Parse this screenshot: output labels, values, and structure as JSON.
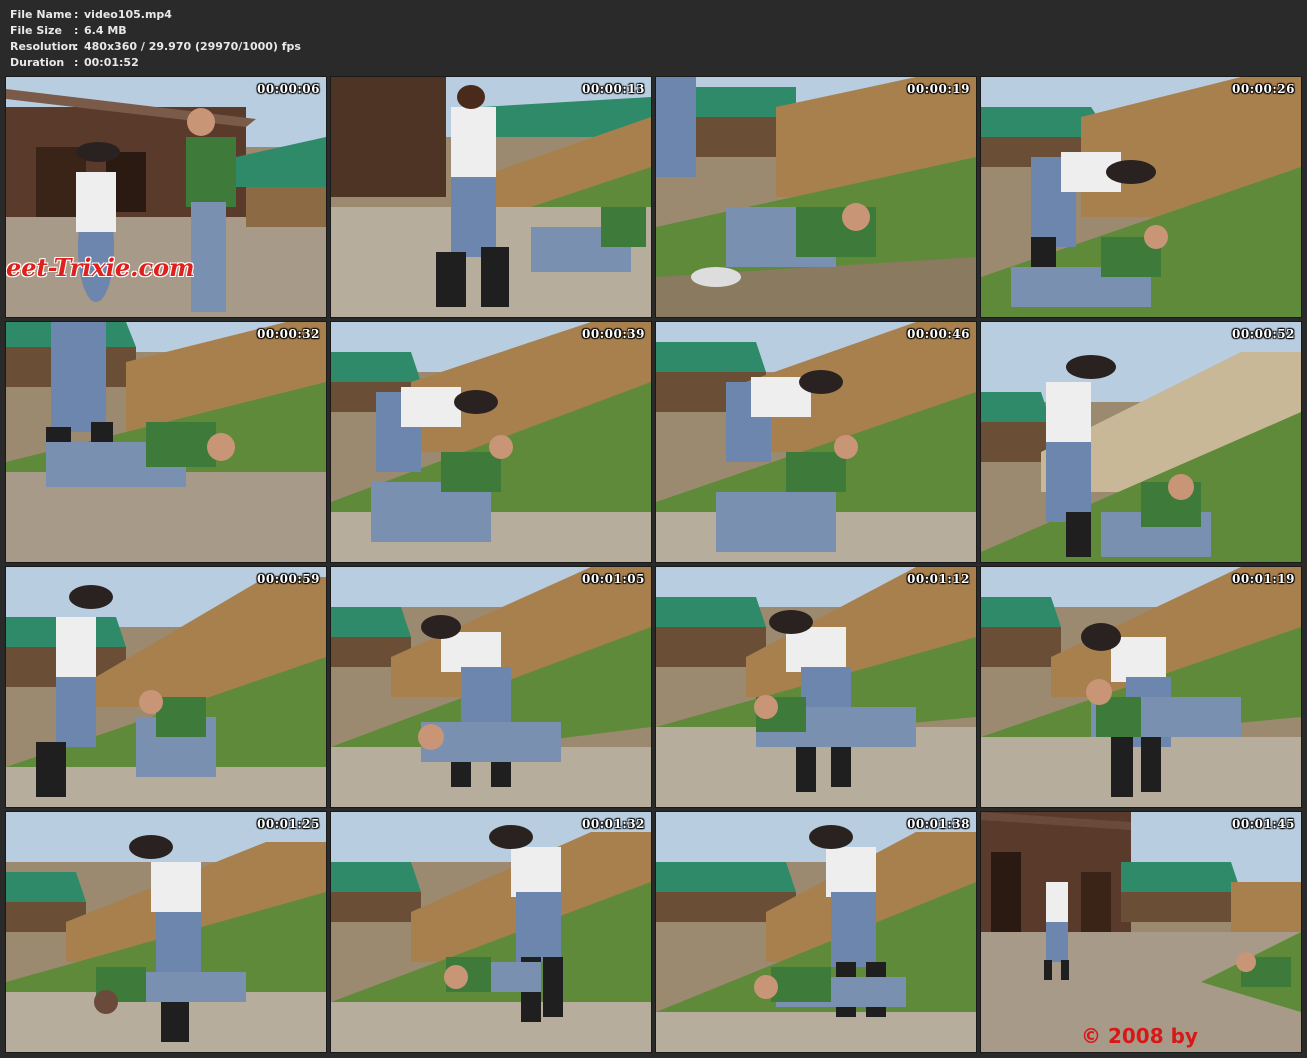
{
  "header": {
    "rows": [
      {
        "key": "File Name",
        "sep": ":",
        "value": "video105.mp4"
      },
      {
        "key": "File Size",
        "sep": ":",
        "value": "6.4 MB"
      },
      {
        "key": "Resolution",
        "sep": ":",
        "value": "480x360 / 29.970 (29970/1000) fps"
      },
      {
        "key": "Duration",
        "sep": ":",
        "value": "00:01:52"
      }
    ]
  },
  "thumbnails": [
    {
      "timestamp": "00:00:06",
      "overlay": "eet-Trixie.com"
    },
    {
      "timestamp": "00:00:13"
    },
    {
      "timestamp": "00:00:19"
    },
    {
      "timestamp": "00:00:26"
    },
    {
      "timestamp": "00:00:32"
    },
    {
      "timestamp": "00:00:39"
    },
    {
      "timestamp": "00:00:46"
    },
    {
      "timestamp": "00:00:52"
    },
    {
      "timestamp": "00:00:59"
    },
    {
      "timestamp": "00:01:05"
    },
    {
      "timestamp": "00:01:12"
    },
    {
      "timestamp": "00:01:19"
    },
    {
      "timestamp": "00:01:25"
    },
    {
      "timestamp": "00:01:32"
    },
    {
      "timestamp": "00:01:38"
    },
    {
      "timestamp": "00:01:45",
      "overlay": "© 2008 by"
    }
  ],
  "colors": {
    "background": "#2a2a2a",
    "header_text": "#e8e8e8",
    "watermark": "#e0201c",
    "sky": "#b9cde0",
    "grass": "#5f8a3a",
    "dirt": "#a68b62",
    "gravel": "#b7ad9c",
    "roof_green": "#2f8a6a",
    "barn": "#5a3a2a"
  }
}
